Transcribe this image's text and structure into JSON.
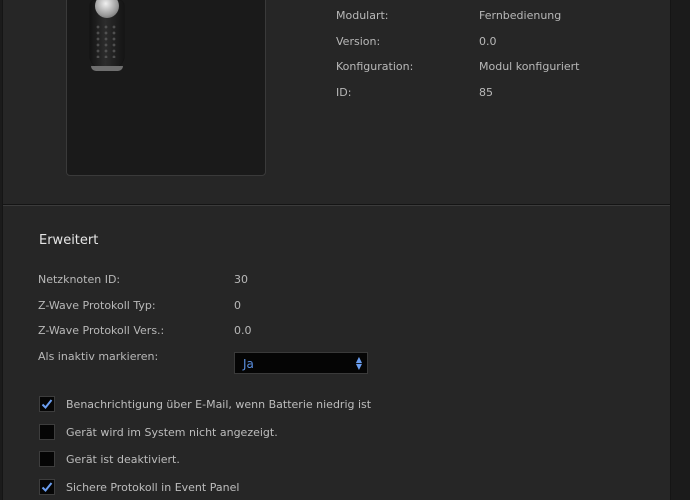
{
  "module_info": {
    "rows": [
      {
        "label": "Modulart:",
        "value": "Fernbedienung"
      },
      {
        "label": "Version:",
        "value": "0.0"
      },
      {
        "label": "Konfiguration:",
        "value": "Modul konfiguriert"
      },
      {
        "label": "ID:",
        "value": "85"
      }
    ]
  },
  "advanced": {
    "title": "Erweitert",
    "rows": [
      {
        "label": "Netzknoten ID:",
        "value": "30"
      },
      {
        "label": "Z-Wave Protokoll Typ:",
        "value": "0"
      },
      {
        "label": "Z-Wave Protokoll Vers.:",
        "value": "0.0"
      }
    ],
    "inactive_label": "Als inaktiv markieren:",
    "inactive_select": {
      "selected": "Ja"
    },
    "checkboxes": [
      {
        "label": "Benachrichtigung über E-Mail, wenn Batterie niedrig ist",
        "checked": true
      },
      {
        "label": "Gerät wird im System nicht angezeigt.",
        "checked": false
      },
      {
        "label": "Gerät ist deaktiviert.",
        "checked": false
      },
      {
        "label": "Sichere Protokoll in Event Panel",
        "checked": true
      }
    ]
  },
  "colors": {
    "accent": "#5a8fe0",
    "panel": "#262626",
    "background": "#1b1b1b"
  },
  "icons": {
    "checkbox_checked": "checkmark-icon",
    "select_arrows": "up-down-arrows-icon"
  }
}
